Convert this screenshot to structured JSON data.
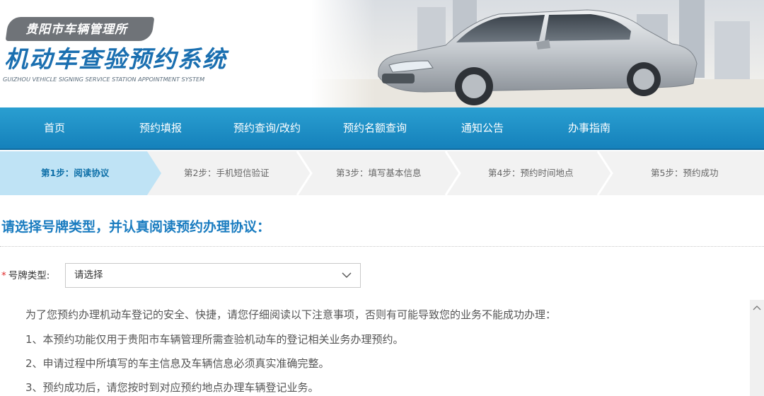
{
  "header": {
    "bureau": "贵阳市车辆管理所",
    "title": "机动车查验预约系统",
    "subtitle": "GUIZHOU VEHICLE SIGNING SERVICE STATION APPOINTMENT SYSTEM"
  },
  "nav": {
    "items": [
      "首页",
      "预约填报",
      "预约查询/改约",
      "预约名额查询",
      "通知公告",
      "办事指南"
    ]
  },
  "steps": {
    "items": [
      "第1步：阅读协议",
      "第2步：手机短信验证",
      "第3步：填写基本信息",
      "第4步：预约时间地点",
      "第5步：预约成功"
    ],
    "active_index": 0
  },
  "main": {
    "heading": "请选择号牌类型，并认真阅读预约办理协议：",
    "plate_type": {
      "required_mark": "*",
      "label": "号牌类型:",
      "value": "请选择"
    },
    "notice": {
      "intro": "为了您预约办理机动车登记的安全、快捷，请您仔细阅读以下注意事项，否则有可能导致您的业务不能成功办理：",
      "items": [
        "1、本预约功能仅用于贵阳市车辆管理所需查验机动车的登记相关业务办理预约。",
        "2、申请过程中所填写的车主信息及车辆信息必须真实准确完整。",
        "3、预约成功后，请您按时到对应预约地点办理车辆登记业务。"
      ]
    }
  },
  "colors": {
    "nav_background": "#1e8fc6",
    "active_step": "#bfe3f5",
    "heading": "#1a7cc0",
    "required": "#e02a2a"
  }
}
